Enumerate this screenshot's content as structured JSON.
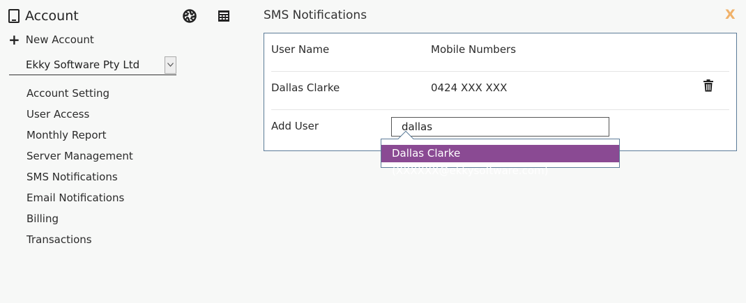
{
  "sidebar": {
    "title": "Account",
    "new_account_label": "New Account",
    "company_select": {
      "value": "Ekky Software Pty Ltd"
    },
    "nav_items": [
      "Account Setting",
      "User Access",
      "Monthly Report",
      "Server Management",
      "SMS Notifications",
      "Email Notifications",
      "Billing",
      "Transactions"
    ]
  },
  "main": {
    "title": "SMS Notifications",
    "close_label": "X",
    "table": {
      "headers": {
        "user_name": "User Name",
        "mobile_numbers": "Mobile Numbers"
      },
      "rows": [
        {
          "user_name": "Dallas Clarke",
          "mobile": "0424 XXX XXX"
        }
      ]
    },
    "add_user": {
      "label": "Add User",
      "value": "dallas",
      "suggestion": "Dallas Clarke (XXXXXX@ekkysoftware.com)"
    }
  },
  "colors": {
    "accent_purple": "#8a4a93",
    "close_orange": "#f0b26b",
    "panel_border": "#5b7b98"
  }
}
